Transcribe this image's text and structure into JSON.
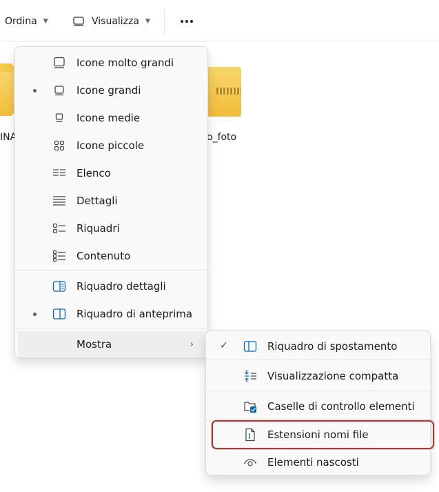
{
  "toolbar": {
    "sort_label": "Ordina",
    "view_label": "Visualizza",
    "chevron": "⌄",
    "more_icon": "more-horizontal-icon"
  },
  "background": {
    "left_item_label": "INA",
    "right_item_label": "o_foto"
  },
  "view_menu": {
    "items": [
      {
        "label": "Icone molto grandi",
        "icon": "extra-large-icons-icon",
        "selected": false
      },
      {
        "label": "Icone grandi",
        "icon": "large-icons-icon",
        "selected": true
      },
      {
        "label": "Icone medie",
        "icon": "medium-icons-icon",
        "selected": false
      },
      {
        "label": "Icone piccole",
        "icon": "small-icons-icon",
        "selected": false
      },
      {
        "label": "Elenco",
        "icon": "list-icon",
        "selected": false
      },
      {
        "label": "Dettagli",
        "icon": "details-icon",
        "selected": false
      },
      {
        "label": "Riquadri",
        "icon": "tiles-icon",
        "selected": false
      },
      {
        "label": "Contenuto",
        "icon": "content-icon",
        "selected": false
      },
      {
        "label": "Riquadro dettagli",
        "icon": "details-pane-icon",
        "selected": false
      },
      {
        "label": "Riquadro di anteprima",
        "icon": "preview-pane-icon",
        "selected": true
      },
      {
        "label": "Mostra",
        "icon": "",
        "submenu_arrow": "›"
      }
    ]
  },
  "show_submenu": {
    "items": [
      {
        "label": "Riquadro di spostamento",
        "icon": "navigation-pane-icon",
        "checked": true,
        "check": "✓"
      },
      {
        "label": "Visualizzazione compatta",
        "icon": "compact-view-icon",
        "checked": false
      },
      {
        "label": "Caselle di controllo elementi",
        "icon": "item-checkboxes-icon",
        "checked": false
      },
      {
        "label": "Estensioni nomi file",
        "icon": "file-extensions-icon",
        "checked": false
      },
      {
        "label": "Elementi nascosti",
        "icon": "hidden-items-icon",
        "checked": false
      }
    ]
  },
  "colors": {
    "accent": "#0067c0",
    "highlight_border": "#b03a2e",
    "folder_yellow": "#f5c84c"
  }
}
